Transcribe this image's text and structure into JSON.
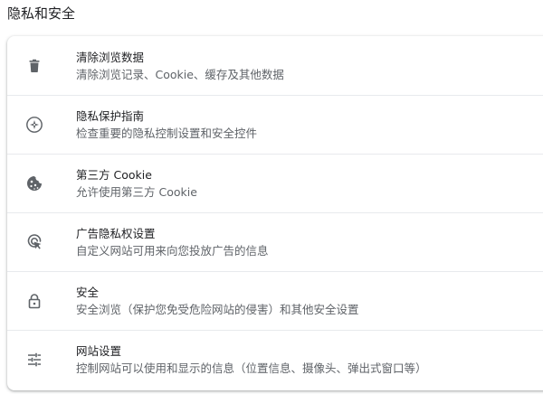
{
  "section": {
    "title": "隐私和安全"
  },
  "items": [
    {
      "icon": "trash-icon",
      "title": "清除浏览数据",
      "subtitle": "清除浏览记录、Cookie、缓存及其他数据"
    },
    {
      "icon": "compass-icon",
      "title": "隐私保护指南",
      "subtitle": "检查重要的隐私控制设置和安全控件"
    },
    {
      "icon": "cookie-icon",
      "title": "第三方 Cookie",
      "subtitle": "允许使用第三方 Cookie"
    },
    {
      "icon": "ad-privacy-icon",
      "title": "广告隐私权设置",
      "subtitle": "自定义网站可用来向您投放广告的信息"
    },
    {
      "icon": "lock-icon",
      "title": "安全",
      "subtitle": "安全浏览（保护您免受危险网站的侵害）和其他安全设置"
    },
    {
      "icon": "tune-icon",
      "title": "网站设置",
      "subtitle": "控制网站可以使用和显示的信息（位置信息、摄像头、弹出式窗口等）"
    }
  ],
  "colors": {
    "icon": "#5f6368",
    "primary_text": "#202124",
    "secondary_text": "#5f6368",
    "divider": "#e8eaed"
  }
}
